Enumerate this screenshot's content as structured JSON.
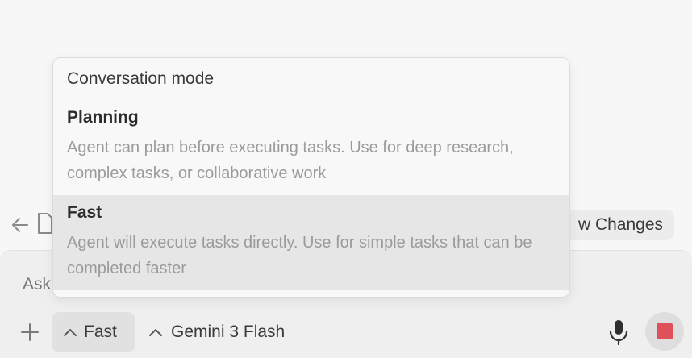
{
  "background": {
    "review_label": "w Changes"
  },
  "composer": {
    "placeholder": "Ask",
    "mode_label": "Fast",
    "model_label": "Gemini 3 Flash"
  },
  "popup": {
    "title": "Conversation mode",
    "options": [
      {
        "name": "Planning",
        "description": "Agent can plan before executing tasks. Use for deep research, complex tasks, or collaborative work",
        "highlighted": false
      },
      {
        "name": "Fast",
        "description": "Agent will execute tasks directly. Use for simple tasks that can be completed faster",
        "highlighted": true
      }
    ]
  },
  "colors": {
    "stop_button": "#e0505a",
    "highlight": "#e6e6e7"
  },
  "icons": {
    "back": "arrow-left-icon",
    "file": "file-icon",
    "plus": "plus-icon",
    "chevron": "chevron-up-icon",
    "mic": "microphone-icon",
    "stop": "stop-icon"
  }
}
